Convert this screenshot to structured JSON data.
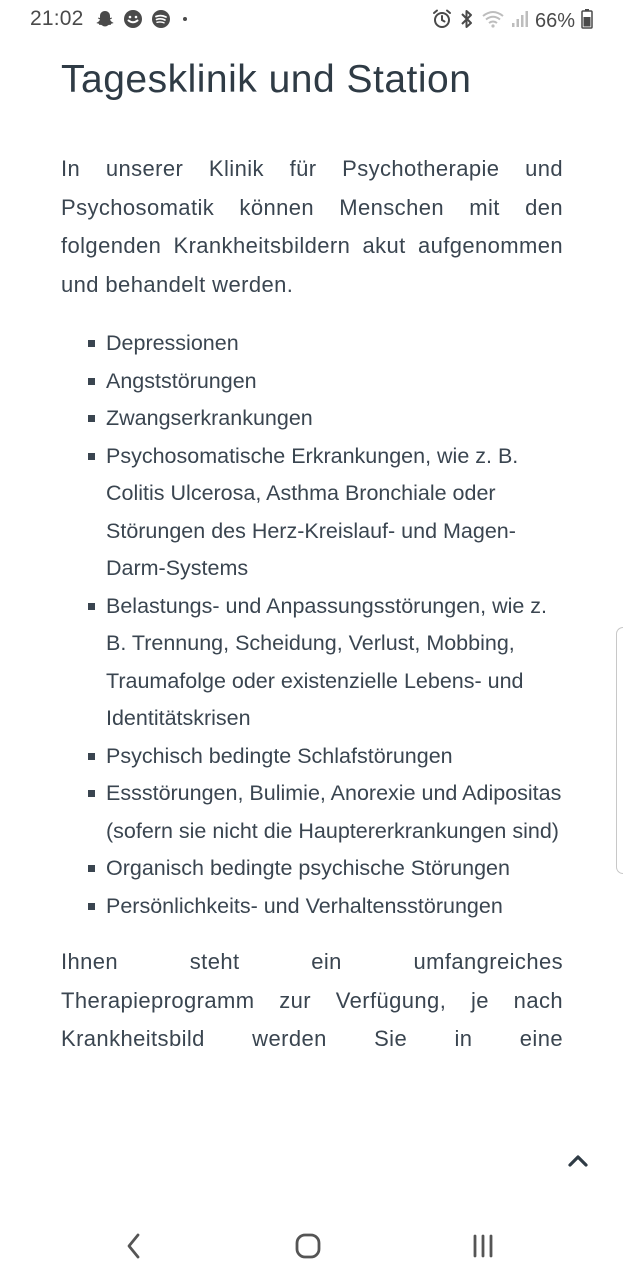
{
  "status_bar": {
    "time": "21:02",
    "battery": "66%",
    "left_icons": [
      "snapchat-icon",
      "messenger-icon",
      "spotify-icon",
      "dot-icon"
    ],
    "right_icons": [
      "alarm-icon",
      "bluetooth-icon",
      "wifi-icon",
      "signal-icon",
      "battery-icon"
    ]
  },
  "page": {
    "title": "Tagesklinik und Station",
    "intro": "In unserer Klinik für Psychotherapie und Psychosomatik können Menschen mit den folgenden Krankheitsbildern akut aufgenommen und behandelt werden.",
    "conditions": [
      "Depressionen",
      "Angststörungen",
      "Zwangserkrankungen",
      "Psychosomatische Erkrankungen, wie z. B. Colitis Ulcerosa, Asthma Bronchiale oder Störungen des Herz-Kreislauf- und Magen-Darm-Systems",
      "Belastungs- und Anpassungsstörungen, wie z. B. Trennung, Scheidung, Verlust, Mobbing, Traumafolge oder existenzielle Lebens- und Identitätskrisen",
      "Psychisch bedingte Schlafstörungen",
      "Essstörungen, Bulimie, Anorexie und Adipositas (sofern sie nicht die Hauptererkrankungen sind)",
      "Organisch bedingte psychische Störungen",
      "Persönlichkeits- und Verhaltensstörungen"
    ],
    "outro": "Ihnen steht ein umfangreiches Therapieprogramm zur Verfügung, je nach Krankheitsbild werden Sie in eine"
  },
  "icons": {
    "scroll_top": "chevron-up-icon",
    "nav_back": "back-icon",
    "nav_home": "home-icon",
    "nav_recents": "recents-icon"
  },
  "colors": {
    "text": "#3a4550",
    "title": "#2f3b45",
    "status": "#4a4a4a"
  }
}
